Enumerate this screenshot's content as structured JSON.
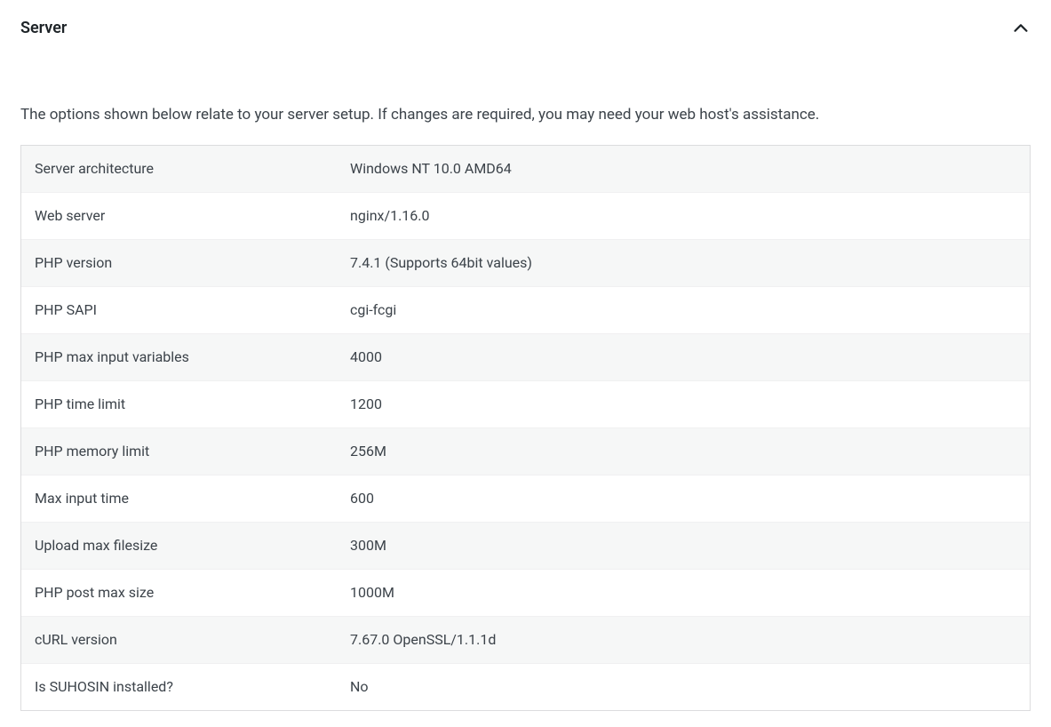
{
  "panel": {
    "title": "Server",
    "description": "The options shown below relate to your server setup. If changes are required, you may need your web host's assistance."
  },
  "rows": [
    {
      "label": "Server architecture",
      "value": "Windows NT 10.0 AMD64"
    },
    {
      "label": "Web server",
      "value": "nginx/1.16.0"
    },
    {
      "label": "PHP version",
      "value": "7.4.1 (Supports 64bit values)"
    },
    {
      "label": "PHP SAPI",
      "value": "cgi-fcgi"
    },
    {
      "label": "PHP max input variables",
      "value": "4000"
    },
    {
      "label": "PHP time limit",
      "value": "1200"
    },
    {
      "label": "PHP memory limit",
      "value": "256M"
    },
    {
      "label": "Max input time",
      "value": "600"
    },
    {
      "label": "Upload max filesize",
      "value": "300M"
    },
    {
      "label": "PHP post max size",
      "value": "1000M"
    },
    {
      "label": "cURL version",
      "value": "7.67.0 OpenSSL/1.1.1d"
    },
    {
      "label": "Is SUHOSIN installed?",
      "value": "No"
    }
  ]
}
